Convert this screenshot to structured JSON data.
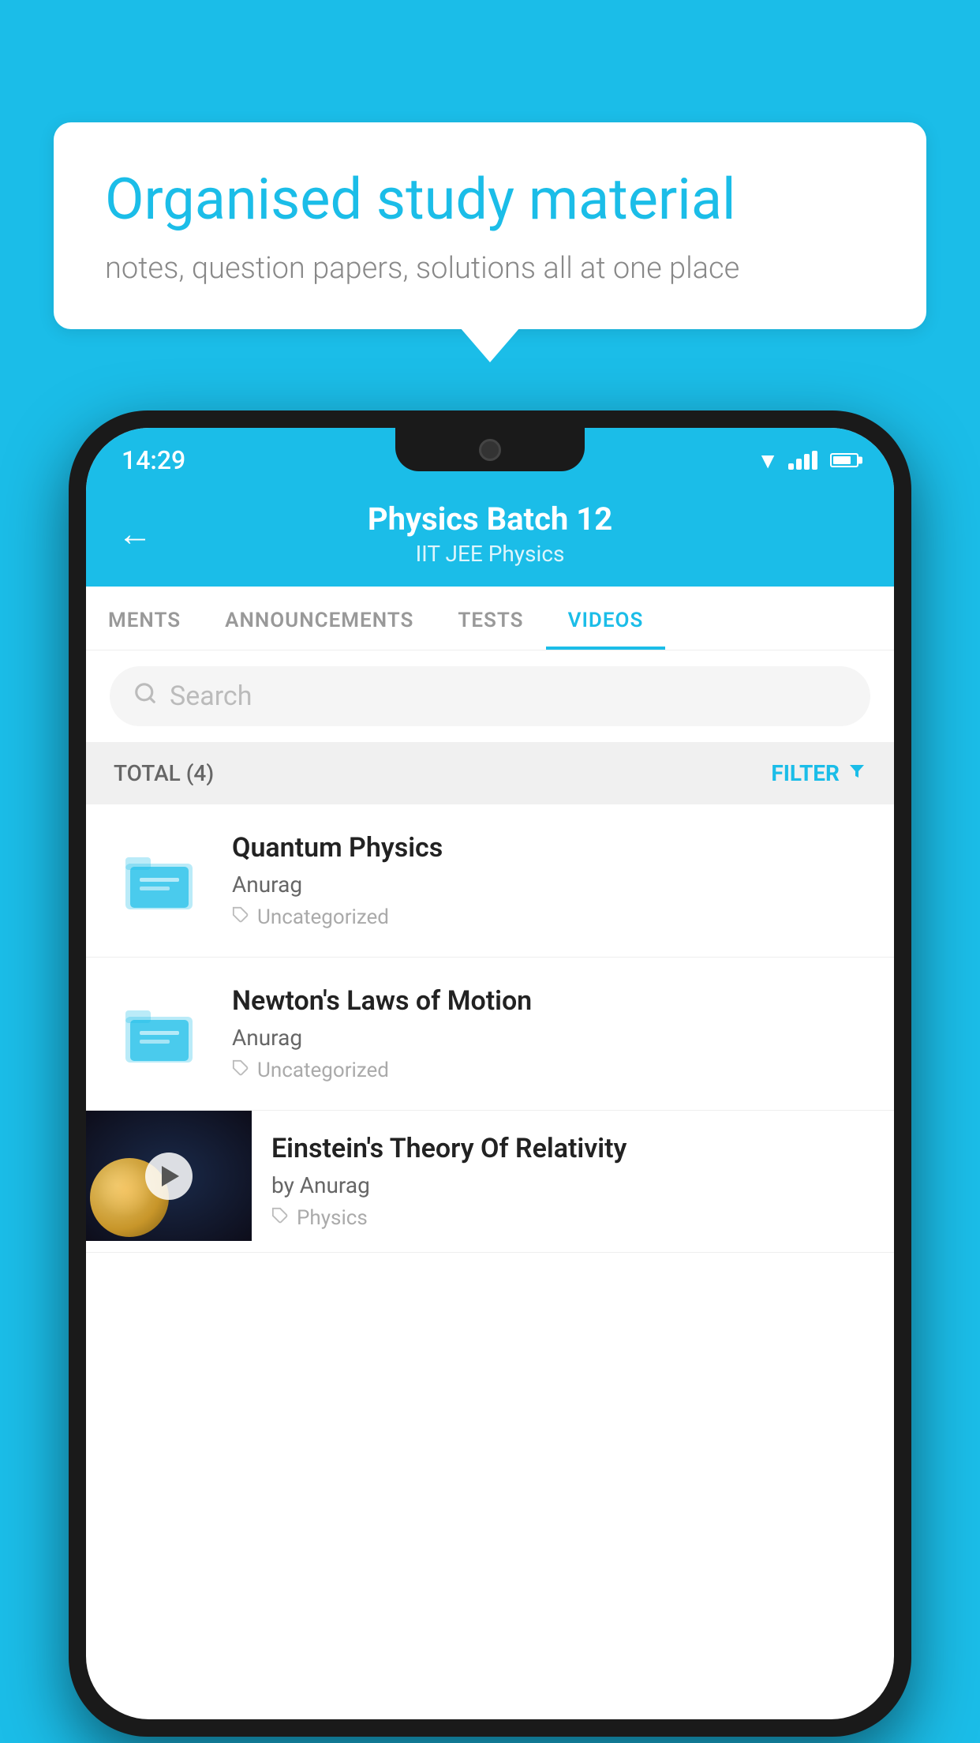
{
  "background_color": "#1BBDE8",
  "speech_bubble": {
    "heading": "Organised study material",
    "subtext": "notes, question papers, solutions all at one place"
  },
  "status_bar": {
    "time": "14:29",
    "wifi": "▼",
    "signal": "▲",
    "battery": "▊"
  },
  "app_header": {
    "back_label": "←",
    "title": "Physics Batch 12",
    "subtitle": "IIT JEE   Physics"
  },
  "tabs": [
    {
      "label": "MENTS",
      "active": false
    },
    {
      "label": "ANNOUNCEMENTS",
      "active": false
    },
    {
      "label": "TESTS",
      "active": false
    },
    {
      "label": "VIDEOS",
      "active": true
    }
  ],
  "search": {
    "placeholder": "Search"
  },
  "filter_bar": {
    "total_label": "TOTAL (4)",
    "filter_label": "FILTER"
  },
  "videos": [
    {
      "title": "Quantum Physics",
      "author": "Anurag",
      "category": "Uncategorized",
      "has_thumb": false
    },
    {
      "title": "Newton's Laws of Motion",
      "author": "Anurag",
      "category": "Uncategorized",
      "has_thumb": false
    },
    {
      "title": "Einstein's Theory Of Relativity",
      "author": "by Anurag",
      "category": "Physics",
      "has_thumb": true
    }
  ]
}
